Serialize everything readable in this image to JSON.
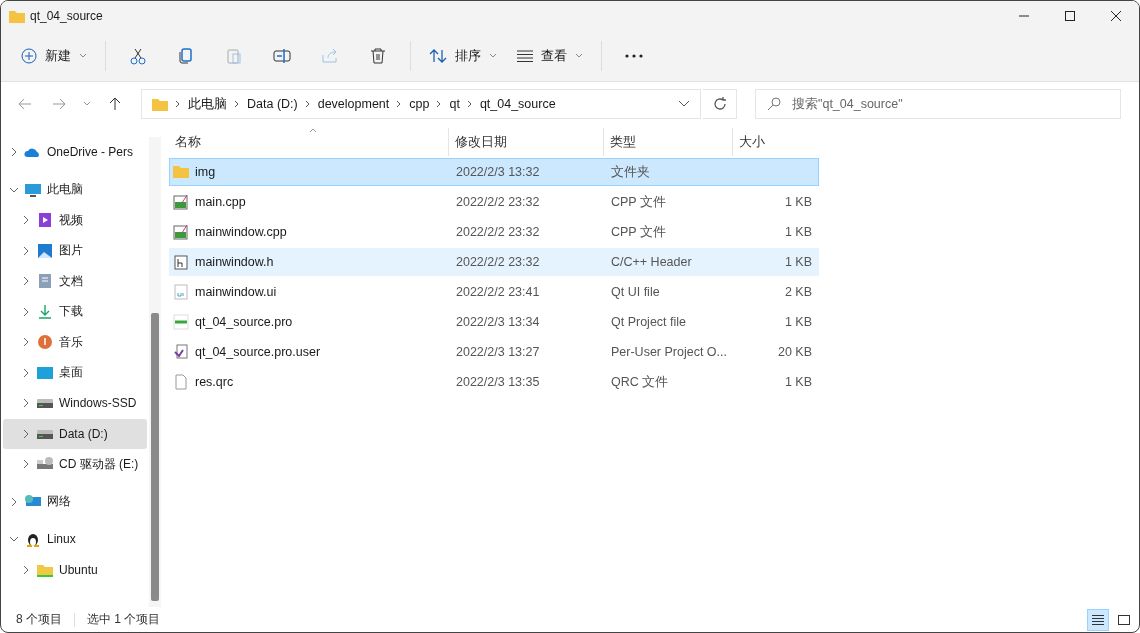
{
  "window": {
    "title": "qt_04_source"
  },
  "toolbar": {
    "new": "新建",
    "sort": "排序",
    "view": "查看"
  },
  "address": {
    "path": [
      "此电脑",
      "Data (D:)",
      "development",
      "cpp",
      "qt",
      "qt_04_source"
    ]
  },
  "search": {
    "placeholder": "搜索\"qt_04_source\""
  },
  "sidebar": {
    "items": [
      {
        "label": "OneDrive - Pers",
        "kind": "cloud",
        "expanded": false,
        "selected": false
      },
      {
        "label": "此电脑",
        "kind": "pc",
        "expanded": true,
        "selected": false,
        "children": [
          {
            "label": "视频",
            "kind": "video",
            "expanded": false,
            "selected": false
          },
          {
            "label": "图片",
            "kind": "pictures",
            "expanded": false,
            "selected": false
          },
          {
            "label": "文档",
            "kind": "docs",
            "expanded": false,
            "selected": false
          },
          {
            "label": "下载",
            "kind": "download",
            "expanded": false,
            "selected": false
          },
          {
            "label": "音乐",
            "kind": "music",
            "expanded": false,
            "selected": false
          },
          {
            "label": "桌面",
            "kind": "desktop",
            "expanded": false,
            "selected": false
          },
          {
            "label": "Windows-SSD",
            "kind": "drive",
            "expanded": false,
            "selected": false
          },
          {
            "label": "Data (D:)",
            "kind": "drive",
            "expanded": false,
            "selected": true
          },
          {
            "label": "CD 驱动器 (E:)",
            "kind": "cd",
            "expanded": false,
            "selected": false
          }
        ]
      },
      {
        "label": "网络",
        "kind": "network",
        "expanded": false,
        "selected": false
      },
      {
        "label": "Linux",
        "kind": "linux",
        "expanded": true,
        "selected": false,
        "children": [
          {
            "label": "Ubuntu",
            "kind": "folder",
            "expanded": false,
            "selected": false
          }
        ]
      }
    ]
  },
  "table": {
    "columns": [
      "名称",
      "修改日期",
      "类型",
      "大小"
    ],
    "rows": [
      {
        "name": "img",
        "date": "2022/2/3 13:32",
        "type": "文件夹",
        "size": "",
        "kind": "folder",
        "selected": true,
        "hovered": false
      },
      {
        "name": "main.cpp",
        "date": "2022/2/2 23:32",
        "type": "CPP 文件",
        "size": "1 KB",
        "kind": "cpp",
        "selected": false,
        "hovered": false
      },
      {
        "name": "mainwindow.cpp",
        "date": "2022/2/2 23:32",
        "type": "CPP 文件",
        "size": "1 KB",
        "kind": "cpp",
        "selected": false,
        "hovered": false
      },
      {
        "name": "mainwindow.h",
        "date": "2022/2/2 23:32",
        "type": "C/C++ Header",
        "size": "1 KB",
        "kind": "header",
        "selected": false,
        "hovered": true
      },
      {
        "name": "mainwindow.ui",
        "date": "2022/2/2 23:41",
        "type": "Qt UI file",
        "size": "2 KB",
        "kind": "ui",
        "selected": false,
        "hovered": false
      },
      {
        "name": "qt_04_source.pro",
        "date": "2022/2/3 13:34",
        "type": "Qt Project file",
        "size": "1 KB",
        "kind": "pro",
        "selected": false,
        "hovered": false
      },
      {
        "name": "qt_04_source.pro.user",
        "date": "2022/2/3 13:27",
        "type": "Per-User Project O...",
        "size": "20 KB",
        "kind": "user",
        "selected": false,
        "hovered": false
      },
      {
        "name": "res.qrc",
        "date": "2022/2/3 13:35",
        "type": "QRC 文件",
        "size": "1 KB",
        "kind": "qrc",
        "selected": false,
        "hovered": false
      }
    ]
  },
  "status_bar": {
    "count": "8 个项目",
    "selection": "选中 1 个项目",
    "views": [
      {
        "kind": "details",
        "selected": true
      },
      {
        "kind": "tiles",
        "selected": false
      }
    ]
  }
}
